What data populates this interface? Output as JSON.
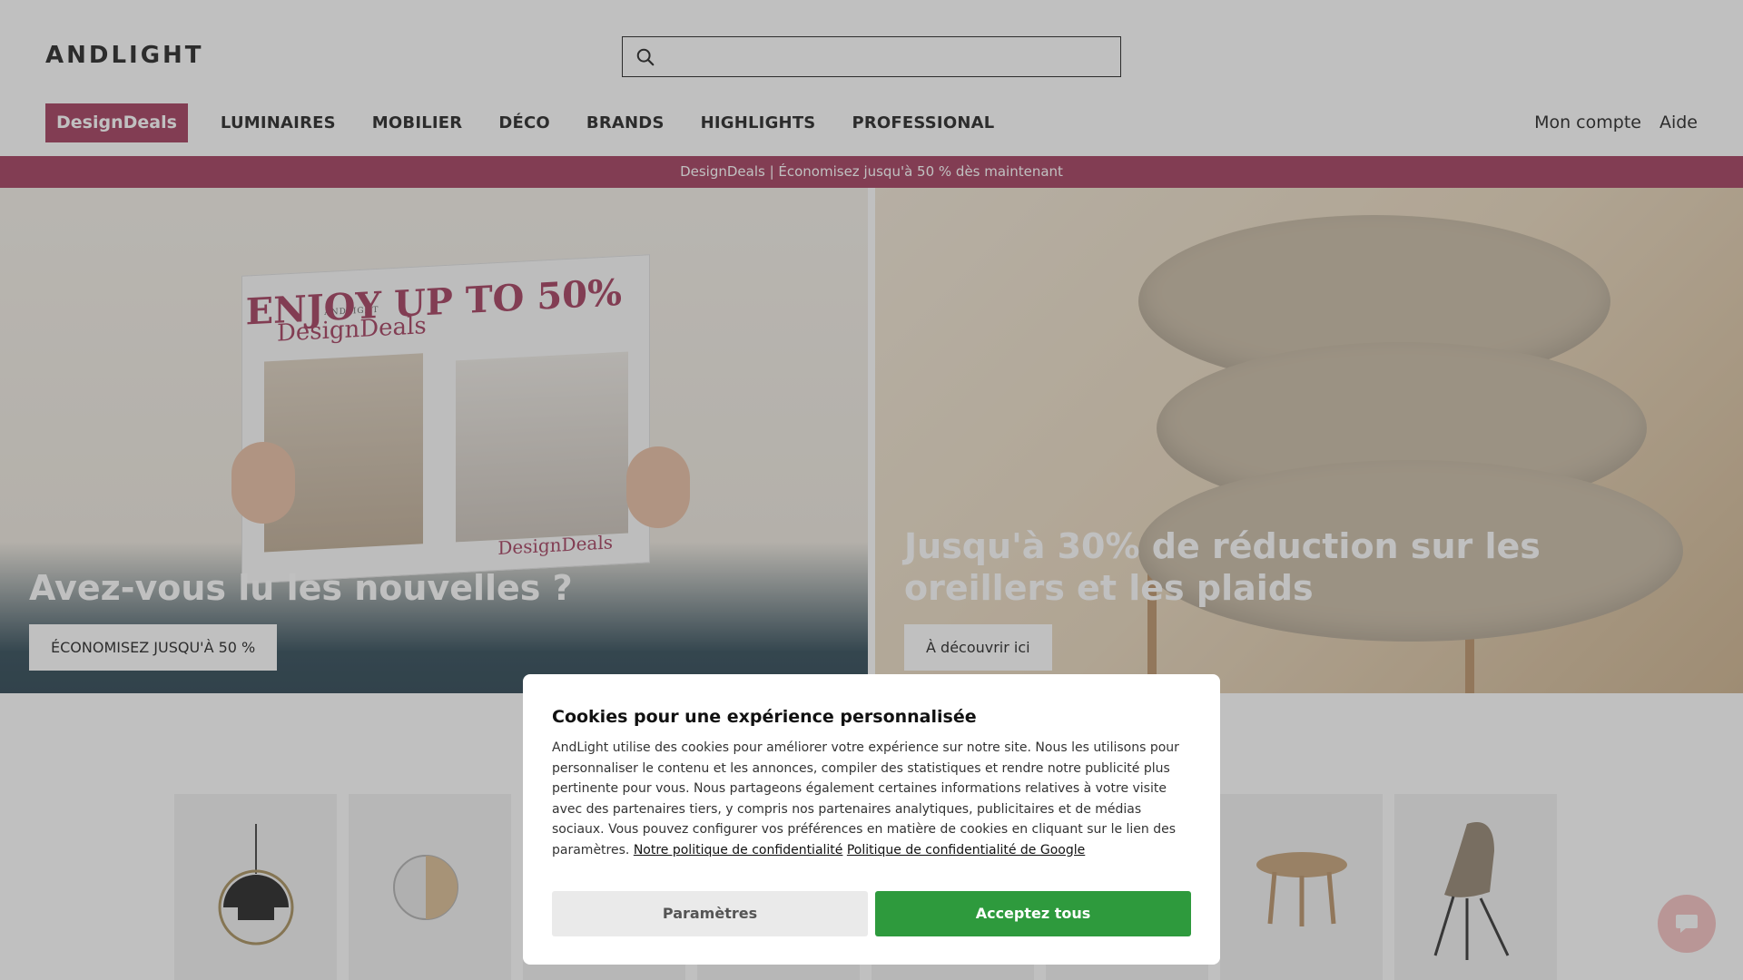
{
  "header": {
    "logo": "ANDLIGHT",
    "search_placeholder": ""
  },
  "nav": {
    "deals_label": "DesignDeals",
    "items": [
      "LUMINAIRES",
      "MOBILIER",
      "DÉCO",
      "BRANDS",
      "HIGHLIGHTS",
      "PROFESSIONAL"
    ],
    "account": "Mon compte",
    "help": "Aide"
  },
  "promo_bar": "DesignDeals | Économisez jusqu'à 50 % dès maintenant",
  "hero": {
    "left": {
      "title": "Avez-vous lu les nouvelles ?",
      "button": "ÉCONOMISEZ JUSQU'À 50 %",
      "paper_brand_small": "ANDLIGHT",
      "paper_brand": "DesignDeals",
      "paper_headline": "ENJOY UP TO 50%",
      "paper_footer": "DesignDeals"
    },
    "right": {
      "title": "Jusqu'à 30% de réduction sur les oreillers et les plaids",
      "button": "À découvrir ici"
    }
  },
  "cookie": {
    "title": "Cookies pour une expérience personnalisée",
    "body": "AndLight utilise des cookies pour améliorer votre expérience sur notre site. Nous les utilisons pour personnaliser le contenu et les annonces, compiler des statistiques et rendre notre publicité plus pertinente pour vous. Nous partageons également certaines informations relatives à votre visite avec des partenaires tiers, y compris nos partenaires analytiques, publicitaires et de médias sociaux. Vous pouvez configurer vos préférences en matière de cookies en cliquant sur le lien des paramètres.",
    "privacy_link": "Notre politique de confidentialité",
    "google_link": "Politique de confidentialité de Google",
    "settings_button": "Paramètres",
    "accept_button": "Acceptez tous"
  },
  "colors": {
    "brand": "#9b2d4f",
    "accept": "#2e9a3d"
  }
}
